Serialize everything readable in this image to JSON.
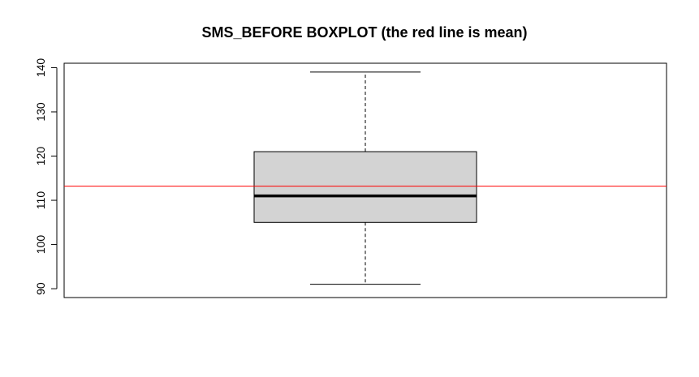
{
  "chart_data": {
    "type": "boxplot",
    "title": "SMS_BEFORE BOXPLOT (the red line is mean)",
    "xlabel": "",
    "ylabel": "",
    "ylim": [
      88,
      141
    ],
    "yticks": [
      90,
      100,
      110,
      120,
      130,
      140
    ],
    "box": {
      "whisker_low": 91,
      "q1": 105,
      "median": 111,
      "q3": 121,
      "whisker_high": 139
    },
    "mean": 113.2,
    "colors": {
      "box_fill": "#d3d3d3",
      "mean_line": "#ff0000",
      "axis": "#000000"
    },
    "grid": false
  }
}
